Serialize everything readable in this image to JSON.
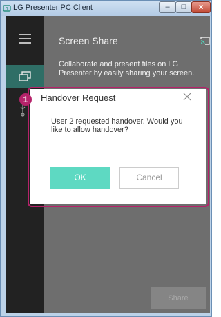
{
  "window": {
    "title": "LG Presenter PC Client",
    "controls": {
      "minimize": "–",
      "maximize": "□",
      "close": "x"
    }
  },
  "sidebar": {
    "items": [
      {
        "icon": "hamburger-menu-icon"
      },
      {
        "icon": "screen-share-icon",
        "active": true
      },
      {
        "icon": "usb-icon"
      }
    ]
  },
  "main": {
    "title": "Screen Share",
    "description": "Collaborate and present files on LG Presenter by easily sharing your screen.",
    "share_label": "Share"
  },
  "dialog": {
    "title": "Handover Request",
    "close": "×",
    "message": "User 2 requested handover. Would you like to allow handover?",
    "ok_label": "OK",
    "cancel_label": "Cancel"
  },
  "annotation": {
    "step_number": "1"
  },
  "colors": {
    "accent": "#5ed9c2",
    "highlight": "#b6226a",
    "sidebar": "#222222",
    "active_tab": "#2f6e66"
  }
}
